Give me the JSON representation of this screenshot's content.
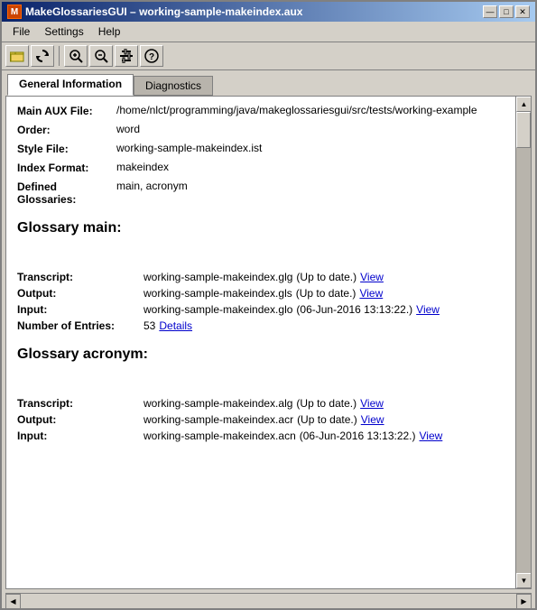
{
  "window": {
    "title": "MakeGlossariesGUI – working-sample-makeindex.aux",
    "icon_label": "M"
  },
  "title_buttons": {
    "minimize": "—",
    "maximize": "□",
    "close": "✕"
  },
  "menu": {
    "items": [
      "File",
      "Settings",
      "Help"
    ]
  },
  "toolbar": {
    "buttons": [
      {
        "name": "open-folder-btn",
        "icon": "📂"
      },
      {
        "name": "refresh-btn",
        "icon": "↺"
      },
      {
        "name": "zoom-in-btn",
        "icon": "🔍+"
      },
      {
        "name": "zoom-out-btn",
        "icon": "🔍-"
      },
      {
        "name": "settings-btn",
        "icon": "⚙"
      },
      {
        "name": "help-btn",
        "icon": "?"
      }
    ]
  },
  "tabs": [
    {
      "label": "General Information",
      "active": true
    },
    {
      "label": "Diagnostics",
      "active": false
    }
  ],
  "general_info": {
    "fields": [
      {
        "label": "Main AUX File:",
        "value": "/home/nlct/programming/java/makeglossariesgui/src/tests/working-example"
      },
      {
        "label": "Order:",
        "value": "word"
      },
      {
        "label": "Style File:",
        "value": "working-sample-makeindex.ist"
      },
      {
        "label": "Index Format:",
        "value": "makeindex"
      },
      {
        "label": "Defined Glossaries:",
        "value": "main, acronym"
      }
    ]
  },
  "glossaries": [
    {
      "name": "Glossary main:",
      "entries": [
        {
          "label": "Transcript:",
          "file": "working-sample-makeindex.glg",
          "status": "(Up to date.)",
          "link": "View"
        },
        {
          "label": "Output:",
          "file": "working-sample-makeindex.gls",
          "status": "(Up to date.)",
          "link": "View"
        },
        {
          "label": "Input:",
          "file": "working-sample-makeindex.glo",
          "status": "(06-Jun-2016 13:13:22.)",
          "link": "View"
        }
      ],
      "entries_count": "53",
      "entries_link": "Details"
    },
    {
      "name": "Glossary acronym:",
      "entries": [
        {
          "label": "Transcript:",
          "file": "working-sample-makeindex.alg",
          "status": "(Up to date.)",
          "link": "View"
        },
        {
          "label": "Output:",
          "file": "working-sample-makeindex.acr",
          "status": "(Up to date.)",
          "link": "View"
        },
        {
          "label": "Input:",
          "file": "working-sample-makeindex.acn",
          "status": "(06-Jun-2016 13:13:22.)",
          "link": "View"
        }
      ],
      "entries_count": null,
      "entries_link": null
    }
  ],
  "num_entries_label": "Number of Entries:"
}
